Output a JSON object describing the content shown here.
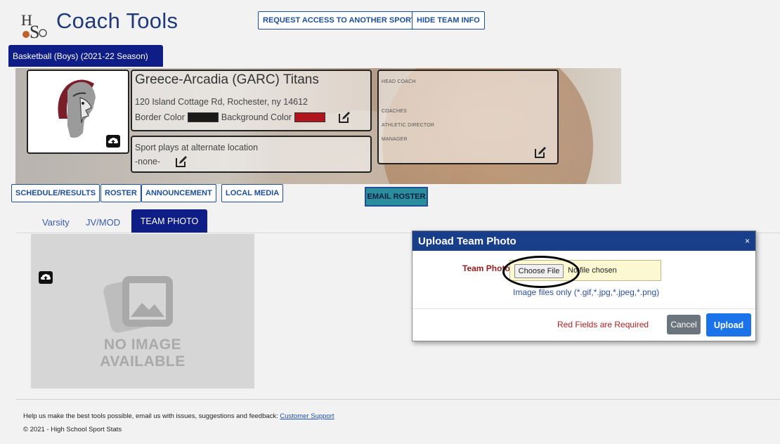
{
  "app": {
    "title": "Coach Tools"
  },
  "header": {
    "request_access": "REQUEST ACCESS TO ANOTHER SPORT",
    "hide_team_info": "HIDE TEAM INFO"
  },
  "sport_tab": "Basketball (Boys) (2021-22 Season)",
  "team": {
    "name": "Greece-Arcadia (GARC) Titans",
    "address": "120 Island Cottage Rd, Rochester, ny 14612",
    "border_color_label": "Border Color",
    "border_color": "#1a1a1a",
    "background_color_label": "Background Color",
    "background_color": "#b0141c",
    "alt_location_label": "Sport plays at alternate location",
    "alt_location_value": "-none-"
  },
  "staff": {
    "head_coach": "HEAD COACH",
    "coaches": "COACHES",
    "athletic_director": "ATHLETIC DIRECTOR",
    "manager": "MANAGER"
  },
  "nav": {
    "schedule": "SCHEDULE/RESULTS",
    "roster": "ROSTER",
    "announcement": "ANNOUNCEMENT",
    "local_media": "LOCAL MEDIA",
    "email_roster": "EMAIL ROSTER"
  },
  "subtabs": {
    "varsity": "Varsity",
    "jvmod": "JV/MOD",
    "team_photo": "TEAM PHOTO"
  },
  "placeholder": {
    "line1": "NO IMAGE",
    "line2": "AVAILABLE"
  },
  "modal": {
    "title": "Upload Team Photo",
    "close": "×",
    "field_label": "Team Photo",
    "choose_file": "Choose File",
    "file_status": "No file chosen",
    "hint": "Image files only (*.gif,*.jpg,*.jpeg,*.png)",
    "required_note": "Red Fields are Required",
    "cancel": "Cancel",
    "upload": "Upload"
  },
  "footer": {
    "feedback_text": "Help us make the best tools possible, email us with issues, suggestions and feedback:",
    "support_link": "Customer Support",
    "copyright": "© 2021 - High School Sport Stats"
  },
  "colors": {
    "primary_dark": "#0f1e87",
    "link_blue": "#1d4e9a",
    "modal_header": "#1a3f8a",
    "upload_button": "#1a73e8"
  }
}
